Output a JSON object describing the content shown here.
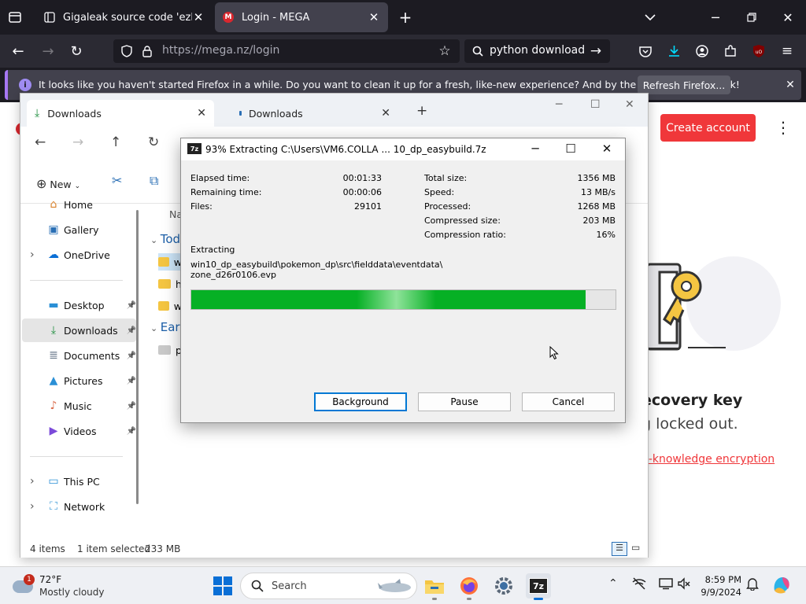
{
  "firefox": {
    "tabs": [
      {
        "title": "Gigaleak source code 'ezbuild",
        "favicon": "github-icon",
        "active": false
      },
      {
        "title": "Login - MEGA",
        "favicon": "mega-icon",
        "active": true
      }
    ],
    "url_prefix": "https://",
    "url_host": "mega.nz/login",
    "search_text": "python download",
    "notification": {
      "message": "It looks like you haven't started Firefox in a while. Do you want to clean it up for a fresh, like-new experience? And by the way, welcome back!",
      "button": "Refresh Firefox..."
    }
  },
  "mega": {
    "create_account": "Create account",
    "heading_fragment": "ecovery key",
    "sub_fragment": "g locked out.",
    "link_fragment": "o-knowledge encryption",
    "accent_color": "#f0373a"
  },
  "explorer": {
    "tabs": [
      {
        "title": "Downloads",
        "active": true
      },
      {
        "title": "Downloads",
        "active": false
      }
    ],
    "new_label": "New",
    "nav": [
      {
        "label": "Home",
        "icon": "home-icon",
        "pinned": false,
        "chevron": false
      },
      {
        "label": "Gallery",
        "icon": "gallery-icon",
        "pinned": false,
        "chevron": false
      },
      {
        "label": "OneDrive",
        "icon": "cloud-icon",
        "pinned": false,
        "chevron": true
      },
      {
        "label": "Desktop",
        "icon": "desktop-icon",
        "pinned": true,
        "chevron": false
      },
      {
        "label": "Downloads",
        "icon": "download-icon",
        "pinned": true,
        "chevron": false,
        "selected": true
      },
      {
        "label": "Documents",
        "icon": "documents-icon",
        "pinned": true,
        "chevron": false
      },
      {
        "label": "Pictures",
        "icon": "pictures-icon",
        "pinned": true,
        "chevron": false
      },
      {
        "label": "Music",
        "icon": "music-icon",
        "pinned": true,
        "chevron": false
      },
      {
        "label": "Videos",
        "icon": "videos-icon",
        "pinned": true,
        "chevron": false
      },
      {
        "label": "This PC",
        "icon": "pc-icon",
        "pinned": false,
        "chevron": true
      },
      {
        "label": "Network",
        "icon": "network-icon",
        "pinned": false,
        "chevron": true
      }
    ],
    "column_header_fragment": "Na",
    "groups": [
      "Tod",
      "Earl"
    ],
    "row_fragments": [
      "w",
      "h",
      "w",
      "p"
    ],
    "status": {
      "items": "4 items",
      "selected": "1 item selected",
      "size": "233 MB"
    }
  },
  "zip": {
    "title": "93% Extracting C:\\Users\\VM6.COLLA ... 10_dp_easybuild.7z",
    "logo": "7z",
    "left_stats": [
      {
        "label": "Elapsed time:",
        "value": "00:01:33"
      },
      {
        "label": "Remaining time:",
        "value": "00:00:06"
      },
      {
        "label": "Files:",
        "value": "29101"
      }
    ],
    "right_stats": [
      {
        "label": "Total size:",
        "value": "1356 MB"
      },
      {
        "label": "Speed:",
        "value": "13 MB/s"
      },
      {
        "label": "Processed:",
        "value": "1268 MB"
      },
      {
        "label": "Compressed size:",
        "value": "203 MB"
      },
      {
        "label": "Compression ratio:",
        "value": "16%"
      }
    ],
    "status_label": "Extracting",
    "path_line1": "win10_dp_easybuild\\pokemon_dp\\src\\fielddata\\eventdata\\",
    "path_line2": "zone_d26r0106.evp",
    "progress_fraction": 0.93,
    "buttons": {
      "background": "Background",
      "pause": "Pause",
      "cancel": "Cancel"
    }
  },
  "taskbar": {
    "weather_temp": "72°F",
    "weather_cond": "Mostly cloudy",
    "weather_badge": "1",
    "search_placeholder": "Search",
    "time": "8:59 PM",
    "date": "9/9/2024"
  }
}
